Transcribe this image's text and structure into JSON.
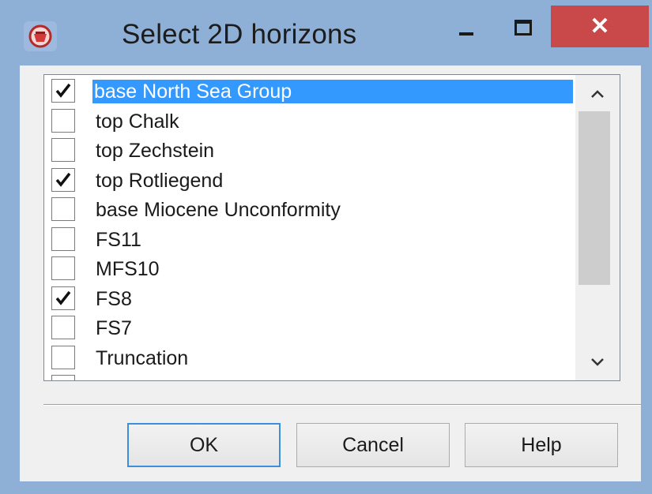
{
  "window": {
    "title": "Select 2D horizons",
    "app_icon": "petrel-app-icon",
    "controls": {
      "minimize": "minimize-icon",
      "maximize": "maximize-icon",
      "close": "✕"
    }
  },
  "horizon_list": {
    "items": [
      {
        "label": "base North Sea Group",
        "checked": true,
        "selected": true
      },
      {
        "label": "top Chalk",
        "checked": false,
        "selected": false
      },
      {
        "label": "top Zechstein",
        "checked": false,
        "selected": false
      },
      {
        "label": "top Rotliegend",
        "checked": true,
        "selected": false
      },
      {
        "label": "base Miocene Unconformity",
        "checked": false,
        "selected": false
      },
      {
        "label": "FS11",
        "checked": false,
        "selected": false
      },
      {
        "label": "MFS10",
        "checked": false,
        "selected": false
      },
      {
        "label": "FS8",
        "checked": true,
        "selected": false
      },
      {
        "label": "FS7",
        "checked": false,
        "selected": false
      },
      {
        "label": "Truncation",
        "checked": false,
        "selected": false
      },
      {
        "label": "",
        "checked": false,
        "selected": false
      }
    ],
    "scroll_up": "^",
    "scroll_down": "v"
  },
  "buttons": {
    "ok": "OK",
    "cancel": "Cancel",
    "help": "Help"
  },
  "colors": {
    "selection": "#3399ff",
    "close_button": "#c9494a",
    "title_bar": "#8eafd6"
  }
}
